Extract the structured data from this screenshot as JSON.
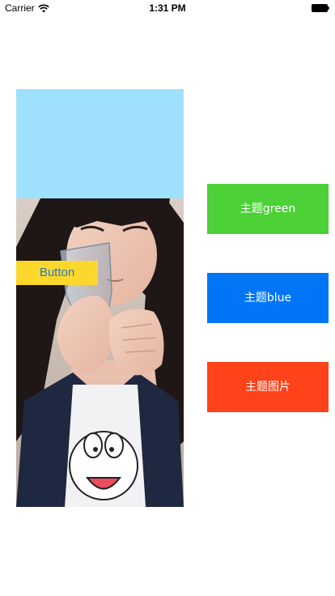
{
  "status_bar": {
    "carrier": "Carrier",
    "time": "1:31 PM",
    "wifi_icon": "wifi-icon",
    "battery_icon": "battery-icon"
  },
  "left_panel": {
    "top_color": "#9fe1fd",
    "photo": "photo-girl-with-glass",
    "button_label": "Button",
    "button_color": "#fdd82c",
    "button_text_color": "#1f79d6"
  },
  "themes": [
    {
      "label": "主题green",
      "color": "#4cd137"
    },
    {
      "label": "主题blue",
      "color": "#0076f7"
    },
    {
      "label": "主题图片",
      "color": "#fe4219"
    }
  ]
}
